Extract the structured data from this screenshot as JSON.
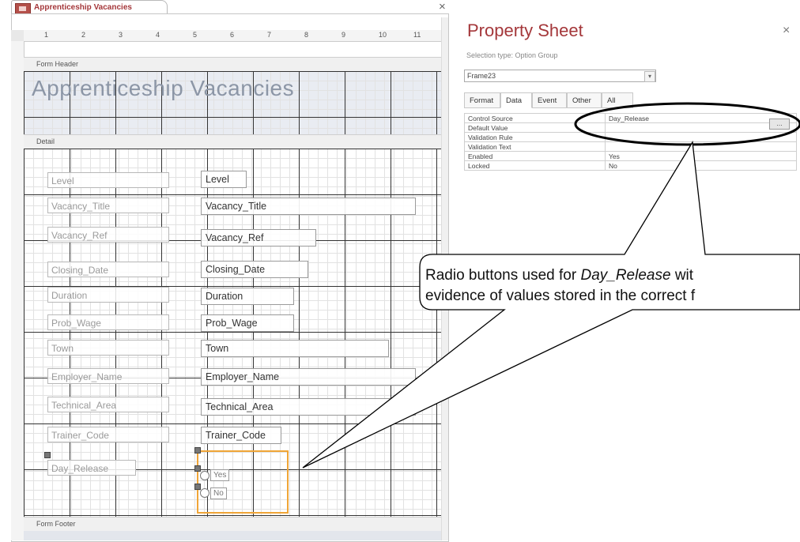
{
  "document": {
    "tab_title": "Apprenticeship Vacancies",
    "close_glyph": "×"
  },
  "ruler": {
    "numbers": [
      "1",
      "2",
      "3",
      "4",
      "5",
      "6",
      "7",
      "8",
      "9",
      "10",
      "11"
    ]
  },
  "form": {
    "header_section": "Form Header",
    "detail_section": "Detail",
    "footer_section": "Form Footer",
    "title": "Apprenticeship Vacancies",
    "fields": [
      {
        "label": "Level",
        "control": "Level"
      },
      {
        "label": "Vacancy_Title",
        "control": "Vacancy_Title"
      },
      {
        "label": "Vacancy_Ref",
        "control": "Vacancy_Ref"
      },
      {
        "label": "Closing_Date",
        "control": "Closing_Date"
      },
      {
        "label": "Duration",
        "control": "Duration"
      },
      {
        "label": "Prob_Wage",
        "control": "Prob_Wage"
      },
      {
        "label": "Town",
        "control": "Town"
      },
      {
        "label": "Employer_Name",
        "control": "Employer_Name"
      },
      {
        "label": "Technical_Area",
        "control": "Technical_Area"
      },
      {
        "label": "Trainer_Code",
        "control": "Trainer_Code"
      }
    ],
    "option_group": {
      "label": "Day_Release",
      "options": [
        "Yes",
        "No"
      ]
    }
  },
  "property_sheet": {
    "title": "Property Sheet",
    "selection_type": "Selection type:  Option Group",
    "selected_object": "Frame23",
    "tabs": [
      "Format",
      "Data",
      "Event",
      "Other",
      "All"
    ],
    "active_tab": "Data",
    "properties": [
      {
        "name": "Control Source",
        "value": "Day_Release"
      },
      {
        "name": "Default Value",
        "value": ""
      },
      {
        "name": "Validation Rule",
        "value": ""
      },
      {
        "name": "Validation Text",
        "value": ""
      },
      {
        "name": "Enabled",
        "value": "Yes"
      },
      {
        "name": "Locked",
        "value": "No"
      }
    ],
    "close_glyph": "×",
    "build_button": "…"
  },
  "annotation": {
    "line1_pre": "Radio buttons used for ",
    "line1_italic": "Day_Release",
    "line1_post": " wit",
    "line2": "evidence of values stored in the correct f",
    "stroke_color": "#000000"
  }
}
